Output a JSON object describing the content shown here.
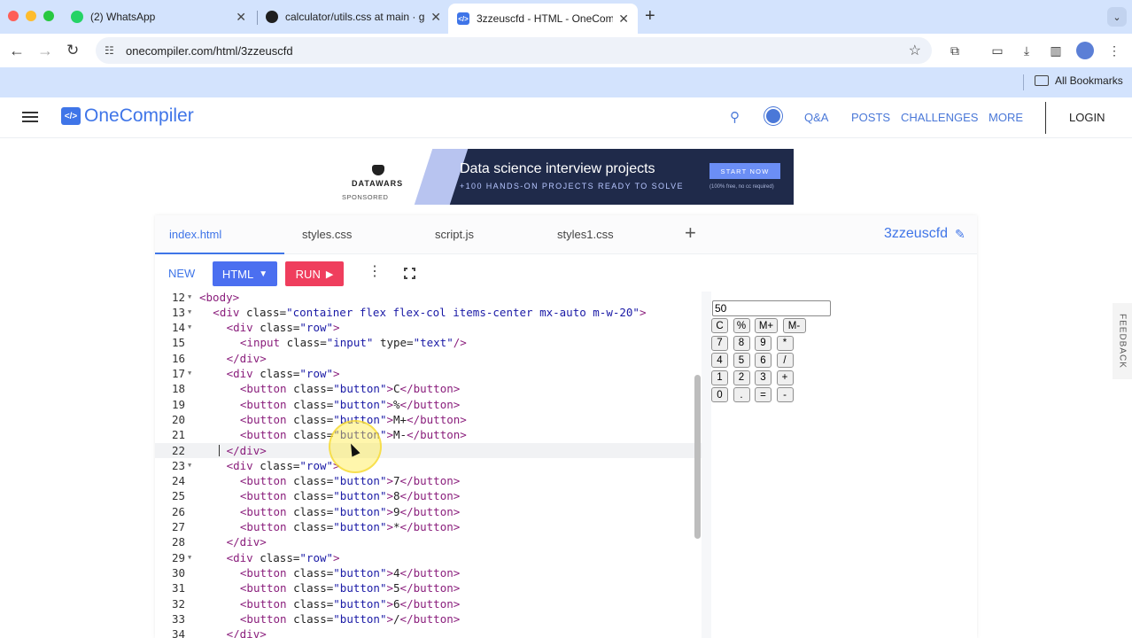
{
  "browser": {
    "tabs": [
      {
        "title": "(2) WhatsApp",
        "favicon_color": "#25d366"
      },
      {
        "title": "calculator/utils.css at main · g",
        "favicon_color": "#1f1f1f"
      },
      {
        "title": "3zzeuscfd - HTML - OneCom",
        "favicon_color": "#3f75e8"
      }
    ],
    "url": "onecompiler.com/html/3zzeuscfd",
    "bookmarks_label": "All Bookmarks"
  },
  "site": {
    "logo_text": "OneCompiler",
    "logo_mark": "</>",
    "nav": [
      "Q&A",
      "POSTS",
      "CHALLENGES",
      "MORE"
    ],
    "login": "LOGIN",
    "feedback": "FEEDBACK"
  },
  "ad": {
    "brand": "DATAWARS",
    "sponsored": "SPONSORED",
    "title": "Data science interview projects",
    "subtitle": "+100 HANDS-ON PROJECTS READY TO SOLVE",
    "cta": "START NOW",
    "fine_print": "(100% free, no cc required)"
  },
  "editor": {
    "files": [
      "index.html",
      "styles.css",
      "script.js",
      "styles1.css"
    ],
    "active_file": "index.html",
    "project_name": "3zzeuscfd",
    "new_label": "NEW",
    "lang_label": "HTML",
    "run_label": "RUN",
    "current_line": 22,
    "lines": [
      {
        "n": 12,
        "fold": true,
        "indent": 0,
        "parts": [
          [
            "tag",
            "<body>"
          ]
        ]
      },
      {
        "n": 13,
        "fold": true,
        "indent": 1,
        "parts": [
          [
            "tag",
            "<div "
          ],
          [
            "attr",
            "class="
          ],
          [
            "str",
            "\"container flex flex-col items-center mx-auto m-w-20\""
          ],
          [
            "tag",
            ">"
          ]
        ]
      },
      {
        "n": 14,
        "fold": true,
        "indent": 2,
        "parts": [
          [
            "tag",
            "<div "
          ],
          [
            "attr",
            "class="
          ],
          [
            "str",
            "\"row\""
          ],
          [
            "tag",
            ">"
          ]
        ]
      },
      {
        "n": 15,
        "fold": false,
        "indent": 3,
        "parts": [
          [
            "tag",
            "<input "
          ],
          [
            "attr",
            "class="
          ],
          [
            "str",
            "\"input\""
          ],
          [
            "attr",
            " type="
          ],
          [
            "str",
            "\"text\""
          ],
          [
            "tag",
            "/>"
          ]
        ]
      },
      {
        "n": 16,
        "fold": false,
        "indent": 2,
        "parts": [
          [
            "tag",
            "</div>"
          ]
        ]
      },
      {
        "n": 17,
        "fold": true,
        "indent": 2,
        "parts": [
          [
            "tag",
            "<div "
          ],
          [
            "attr",
            "class="
          ],
          [
            "str",
            "\"row\""
          ],
          [
            "tag",
            ">"
          ]
        ]
      },
      {
        "n": 18,
        "fold": false,
        "indent": 3,
        "parts": [
          [
            "tag",
            "<button "
          ],
          [
            "attr",
            "class="
          ],
          [
            "str",
            "\"button\""
          ],
          [
            "tag",
            ">"
          ],
          [
            "plain",
            "C"
          ],
          [
            "tag",
            "</button>"
          ]
        ]
      },
      {
        "n": 19,
        "fold": false,
        "indent": 3,
        "parts": [
          [
            "tag",
            "<button "
          ],
          [
            "attr",
            "class="
          ],
          [
            "str",
            "\"button\""
          ],
          [
            "tag",
            ">"
          ],
          [
            "plain",
            "%"
          ],
          [
            "tag",
            "</button>"
          ]
        ]
      },
      {
        "n": 20,
        "fold": false,
        "indent": 3,
        "parts": [
          [
            "tag",
            "<button "
          ],
          [
            "attr",
            "class="
          ],
          [
            "str",
            "\"button\""
          ],
          [
            "tag",
            ">"
          ],
          [
            "plain",
            "M+"
          ],
          [
            "tag",
            "</button>"
          ]
        ]
      },
      {
        "n": 21,
        "fold": false,
        "indent": 3,
        "parts": [
          [
            "tag",
            "<button "
          ],
          [
            "attr",
            "class="
          ],
          [
            "str",
            "\"button\""
          ],
          [
            "tag",
            ">"
          ],
          [
            "plain",
            "M-"
          ],
          [
            "tag",
            "</button>"
          ]
        ]
      },
      {
        "n": 22,
        "fold": false,
        "indent": 2,
        "parts": [
          [
            "tag",
            "</div>"
          ]
        ]
      },
      {
        "n": 23,
        "fold": true,
        "indent": 2,
        "parts": [
          [
            "tag",
            "<div "
          ],
          [
            "attr",
            "class="
          ],
          [
            "str",
            "\"row\""
          ],
          [
            "tag",
            ">"
          ]
        ]
      },
      {
        "n": 24,
        "fold": false,
        "indent": 3,
        "parts": [
          [
            "tag",
            "<button "
          ],
          [
            "attr",
            "class="
          ],
          [
            "str",
            "\"button\""
          ],
          [
            "tag",
            ">"
          ],
          [
            "plain",
            "7"
          ],
          [
            "tag",
            "</button>"
          ]
        ]
      },
      {
        "n": 25,
        "fold": false,
        "indent": 3,
        "parts": [
          [
            "tag",
            "<button "
          ],
          [
            "attr",
            "class="
          ],
          [
            "str",
            "\"button\""
          ],
          [
            "tag",
            ">"
          ],
          [
            "plain",
            "8"
          ],
          [
            "tag",
            "</button>"
          ]
        ]
      },
      {
        "n": 26,
        "fold": false,
        "indent": 3,
        "parts": [
          [
            "tag",
            "<button "
          ],
          [
            "attr",
            "class="
          ],
          [
            "str",
            "\"button\""
          ],
          [
            "tag",
            ">"
          ],
          [
            "plain",
            "9"
          ],
          [
            "tag",
            "</button>"
          ]
        ]
      },
      {
        "n": 27,
        "fold": false,
        "indent": 3,
        "parts": [
          [
            "tag",
            "<button "
          ],
          [
            "attr",
            "class="
          ],
          [
            "str",
            "\"button\""
          ],
          [
            "tag",
            ">"
          ],
          [
            "plain",
            "*"
          ],
          [
            "tag",
            "</button>"
          ]
        ]
      },
      {
        "n": 28,
        "fold": false,
        "indent": 2,
        "parts": [
          [
            "tag",
            "</div>"
          ]
        ]
      },
      {
        "n": 29,
        "fold": true,
        "indent": 2,
        "parts": [
          [
            "tag",
            "<div "
          ],
          [
            "attr",
            "class="
          ],
          [
            "str",
            "\"row\""
          ],
          [
            "tag",
            ">"
          ]
        ]
      },
      {
        "n": 30,
        "fold": false,
        "indent": 3,
        "parts": [
          [
            "tag",
            "<button "
          ],
          [
            "attr",
            "class="
          ],
          [
            "str",
            "\"button\""
          ],
          [
            "tag",
            ">"
          ],
          [
            "plain",
            "4"
          ],
          [
            "tag",
            "</button>"
          ]
        ]
      },
      {
        "n": 31,
        "fold": false,
        "indent": 3,
        "parts": [
          [
            "tag",
            "<button "
          ],
          [
            "attr",
            "class="
          ],
          [
            "str",
            "\"button\""
          ],
          [
            "tag",
            ">"
          ],
          [
            "plain",
            "5"
          ],
          [
            "tag",
            "</button>"
          ]
        ]
      },
      {
        "n": 32,
        "fold": false,
        "indent": 3,
        "parts": [
          [
            "tag",
            "<button "
          ],
          [
            "attr",
            "class="
          ],
          [
            "str",
            "\"button\""
          ],
          [
            "tag",
            ">"
          ],
          [
            "plain",
            "6"
          ],
          [
            "tag",
            "</button>"
          ]
        ]
      },
      {
        "n": 33,
        "fold": false,
        "indent": 3,
        "parts": [
          [
            "tag",
            "<button "
          ],
          [
            "attr",
            "class="
          ],
          [
            "str",
            "\"button\""
          ],
          [
            "tag",
            ">"
          ],
          [
            "plain",
            "/"
          ],
          [
            "tag",
            "</button>"
          ]
        ]
      },
      {
        "n": 34,
        "fold": false,
        "indent": 2,
        "parts": [
          [
            "tag",
            "</div>"
          ]
        ]
      }
    ]
  },
  "preview": {
    "input_value": "50",
    "rows": [
      [
        "C",
        "%",
        "M+",
        "M-"
      ],
      [
        "7",
        "8",
        "9",
        "*"
      ],
      [
        "4",
        "5",
        "6",
        "/"
      ],
      [
        "1",
        "2",
        "3",
        "+"
      ],
      [
        "0",
        ".",
        "=",
        "-"
      ]
    ]
  },
  "colors": {
    "accent": "#3f75e8",
    "run": "#ef3e5d",
    "lang": "#4b6ff0"
  }
}
